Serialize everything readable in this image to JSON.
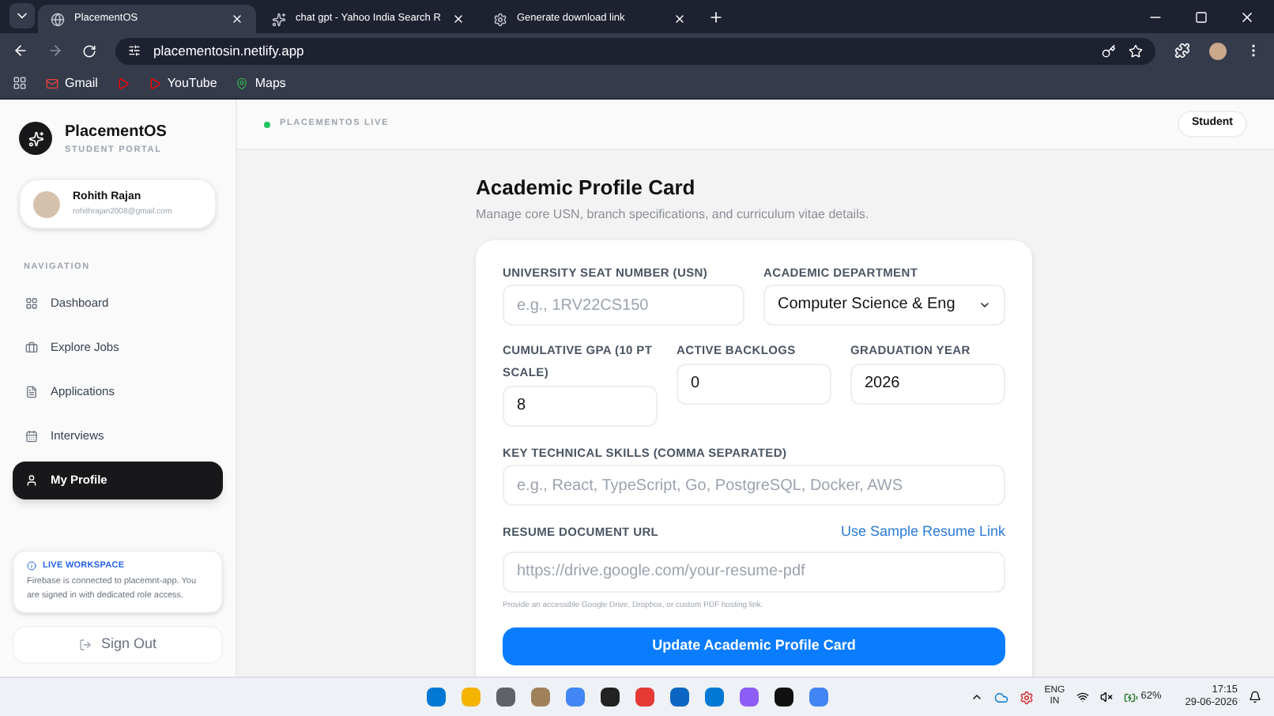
{
  "browser": {
    "tabs": [
      {
        "title": "PlacementOS",
        "selected": true,
        "kind": "globe"
      },
      {
        "title": "chat gpt - Yahoo India Search R",
        "selected": false,
        "kind": "yahoo"
      },
      {
        "title": "Generate download link",
        "selected": false,
        "kind": "gear"
      }
    ],
    "url": "placementosin.netlify.app",
    "bookmarks": [
      {
        "label": "Gmail",
        "kind": "gmail"
      },
      {
        "kind": "youtube"
      },
      {
        "label": "YouTube",
        "kind": "youtube"
      },
      {
        "label": "Maps",
        "kind": "maps"
      }
    ]
  },
  "sidebar": {
    "brand": "PlacementOS",
    "subtitle": "STUDENT PORTAL",
    "user_name": "Rohith Rajan",
    "user_email": "rohithrajan2008@gmail.com",
    "nav_heading": "NAVIGATION",
    "nav": [
      {
        "label": "Dashboard",
        "kind": "grid",
        "selected": false
      },
      {
        "label": "Explore Jobs",
        "kind": "briefcase",
        "selected": false
      },
      {
        "label": "Applications",
        "kind": "file",
        "selected": false
      },
      {
        "label": "Interviews",
        "kind": "calendar",
        "selected": false
      },
      {
        "label": "My Profile",
        "kind": "user",
        "selected": true
      }
    ],
    "workspace_title": "LIVE WORKSPACE",
    "workspace_text": "Firebase is connected to placemnt-app. You are signed in with dedicated role access.",
    "sign_out": "Sign Out"
  },
  "header": {
    "status": "PLACEMENTOS LIVE",
    "role": "Student"
  },
  "form": {
    "title": "Academic Profile Card",
    "subtitle": "Manage core USN, branch specifications, and curriculum vitae details.",
    "usn": {
      "label": "UNIVERSITY SEAT NUMBER (USN)",
      "placeholder": "e.g., 1RV22CS150"
    },
    "department": {
      "label": "ACADEMIC DEPARTMENT",
      "value": "Computer Science & Eng"
    },
    "gpa": {
      "label": "CUMULATIVE GPA (10 PT SCALE)",
      "value": "8"
    },
    "backlogs": {
      "label": "ACTIVE BACKLOGS",
      "value": "0"
    },
    "year": {
      "label": "GRADUATION YEAR",
      "value": "2026"
    },
    "skills": {
      "label": "KEY TECHNICAL SKILLS (COMMA SEPARATED)",
      "placeholder": "e.g., React, TypeScript, Go, PostgreSQL, Docker, AWS"
    },
    "resume": {
      "label": "RESUME DOCUMENT URL",
      "link": "Use Sample Resume Link",
      "placeholder": "https://drive.google.com/your-resume-pdf",
      "hint": "Provide an accessible Google Drive, Dropbox, or custom PDF hosting link."
    },
    "submit": "Update Academic Profile Card"
  },
  "taskbar": {
    "language": "ENG",
    "region": "IN",
    "battery": "62%",
    "time": "17:15",
    "date": "29-06-2026"
  }
}
